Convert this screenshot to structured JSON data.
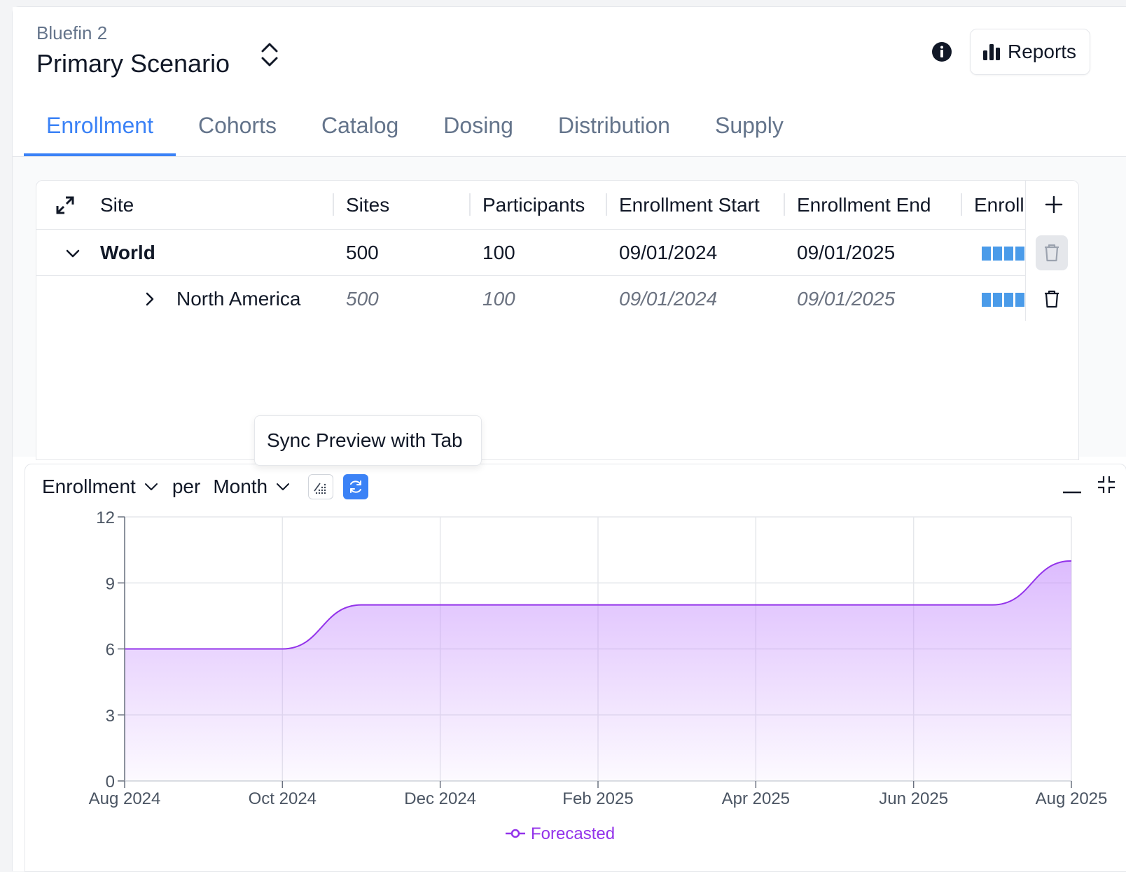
{
  "header": {
    "project": "Bluefin 2",
    "scenario": "Primary Scenario",
    "reports_label": "Reports"
  },
  "tabs": [
    {
      "label": "Enrollment",
      "active": true
    },
    {
      "label": "Cohorts"
    },
    {
      "label": "Catalog"
    },
    {
      "label": "Dosing"
    },
    {
      "label": "Distribution"
    },
    {
      "label": "Supply"
    }
  ],
  "table": {
    "columns": [
      "Site",
      "Sites",
      "Participants",
      "Enrollment Start",
      "Enrollment End",
      "Enroll"
    ],
    "rows": [
      {
        "site": "World",
        "sites": "500",
        "participants": "100",
        "start": "09/01/2024",
        "end": "09/01/2025"
      },
      {
        "site": "North America",
        "sites": "500",
        "participants": "100",
        "start": "09/01/2024",
        "end": "09/01/2025"
      }
    ]
  },
  "tooltip": "Sync Preview with Tab",
  "preview": {
    "metric": "Enrollment",
    "per": "per",
    "period": "Month"
  },
  "colors": {
    "accent": "#3b82f6",
    "series": "#9333ea",
    "bars": "#4a9be9"
  },
  "chart_data": {
    "type": "area",
    "x": [
      "Aug 2024",
      "Sep 2024",
      "Oct 2024",
      "Nov 2024",
      "Dec 2024",
      "Jan 2025",
      "Feb 2025",
      "Mar 2025",
      "Apr 2025",
      "May 2025",
      "Jun 2025",
      "Jul 2025",
      "Aug 2025"
    ],
    "series": [
      {
        "name": "Forecasted",
        "values": [
          6,
          6,
          6,
          8,
          8,
          8,
          8,
          8,
          8,
          8,
          8,
          8,
          10
        ]
      }
    ],
    "x_tick_labels": [
      "Aug 2024",
      "Oct 2024",
      "Dec 2024",
      "Feb 2025",
      "Apr 2025",
      "Jun 2025",
      "Aug 2025"
    ],
    "y_ticks": [
      0,
      3,
      6,
      9,
      12
    ],
    "ylim": [
      0,
      12
    ],
    "grid": true,
    "legend": "bottom-center"
  }
}
